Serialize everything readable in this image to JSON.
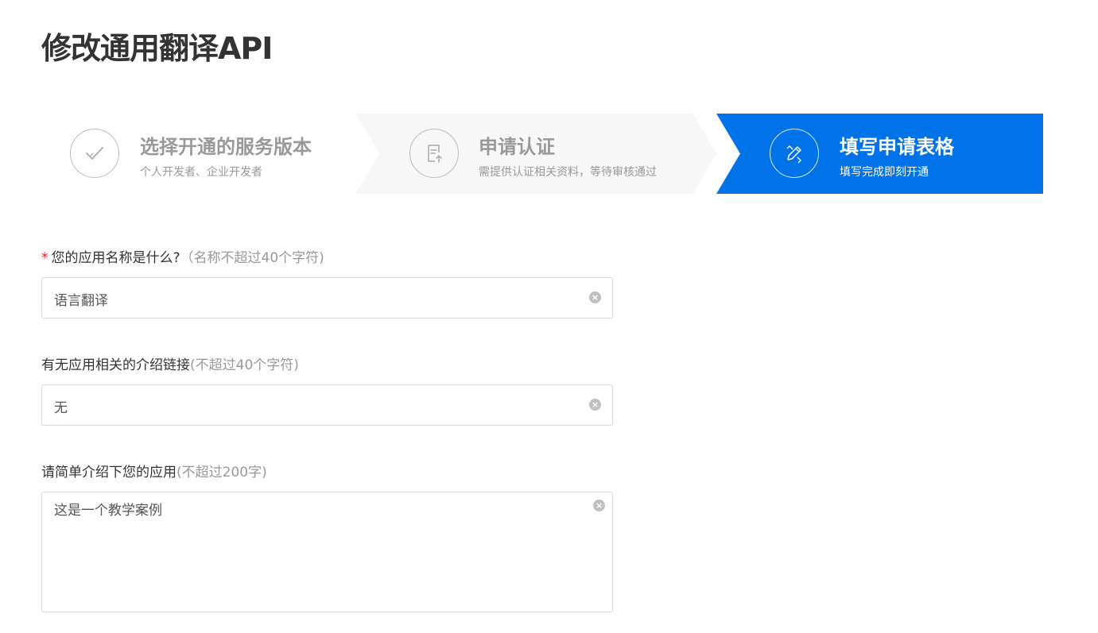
{
  "page": {
    "title": "修改通用翻译API"
  },
  "steps": [
    {
      "title": "选择开通的服务版本",
      "subtitle": "个人开发者、企业开发者",
      "icon": "check-icon",
      "state": "done"
    },
    {
      "title": "申请认证",
      "subtitle": "需提供认证相关资料，等待审核通过",
      "icon": "document-upload-icon",
      "state": "done"
    },
    {
      "title": "填写申请表格",
      "subtitle": "填写完成即刻开通",
      "icon": "pencil-ruler-icon",
      "state": "active"
    }
  ],
  "colors": {
    "active_step": "#0073e8",
    "required_mark": "#e0242b",
    "hint": "#999999"
  },
  "form": {
    "app_name": {
      "required_mark": "*",
      "label": "您的应用名称是什么?",
      "hint": "（名称不超过40个字符)",
      "value": "语言翻译"
    },
    "intro_link": {
      "label": "有无应用相关的介绍链接",
      "hint": "(不超过40个字符)",
      "value": "无"
    },
    "description": {
      "label": "请简单介绍下您的应用",
      "hint": "(不超过200字)",
      "value": "这是一个教学案例"
    },
    "clear_glyph": "×"
  }
}
